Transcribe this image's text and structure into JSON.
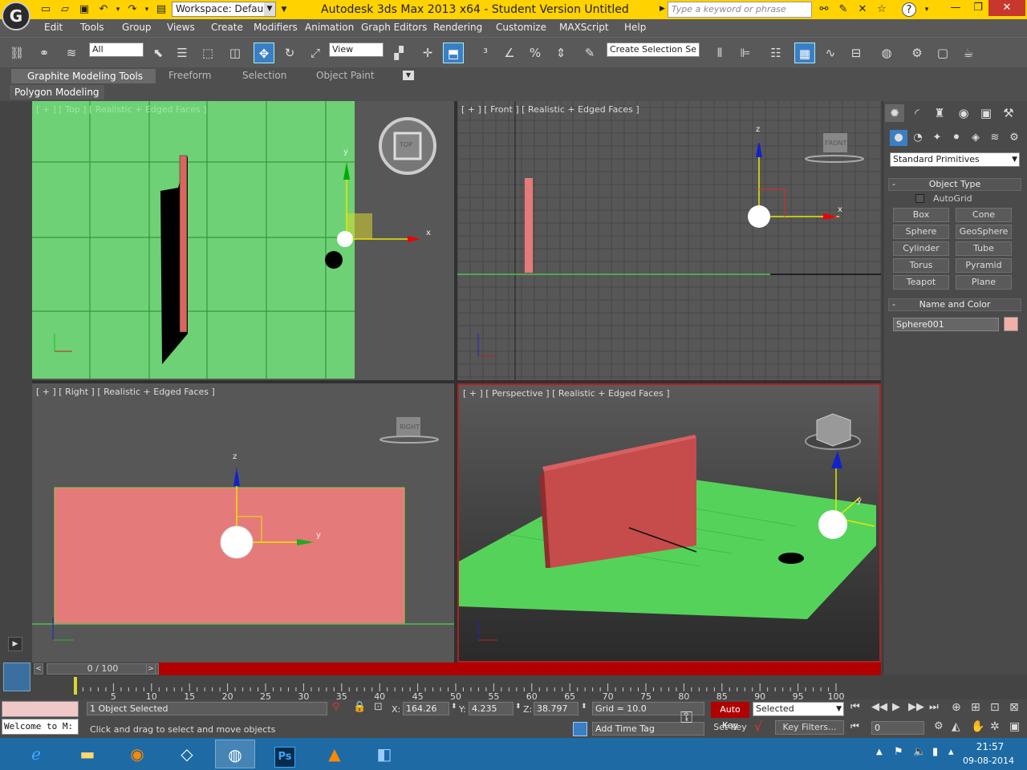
{
  "titlebar": {
    "logo": "G",
    "workspace_label": "Workspace: Default",
    "app_title": "Autodesk 3ds Max  2013 x64   - Student Version    Untitled",
    "search_placeholder": "Type a keyword or phrase",
    "minimize": "—",
    "restore": "❐",
    "close": "✕"
  },
  "menu": [
    "Edit",
    "Tools",
    "Group",
    "Views",
    "Create",
    "Modifiers",
    "Animation",
    "Graph Editors",
    "Rendering",
    "Customize",
    "MAXScript",
    "Help"
  ],
  "toolbar": {
    "filter": "All",
    "refcoord": "View",
    "named_selection": "Create Selection Se"
  },
  "ribbon": {
    "tabs": [
      "Graphite Modeling Tools",
      "Freeform",
      "Selection",
      "Object Paint"
    ],
    "active_tab": "Graphite Modeling Tools",
    "panel": "Polygon Modeling"
  },
  "viewports": {
    "top": {
      "label": "[ + ] [ Top ] [ Realistic + Edged Faces ]",
      "cube": "TOP"
    },
    "front": {
      "label": "[ + ] [ Front ] [ Realistic + Edged Faces ]",
      "cube": "FRONT"
    },
    "right": {
      "label": "[ + ] [ Right ] [ Realistic + Edged Faces ]",
      "cube": "RIGHT"
    },
    "perspective": {
      "label": "[ + ] [ Perspective ] [ Realistic + Edged Faces ]"
    },
    "axes": {
      "x": "x",
      "y": "y",
      "z": "z"
    }
  },
  "command_panel": {
    "category": "Standard Primitives",
    "object_type_title": "Object Type",
    "autogrid": "AutoGrid",
    "buttons": [
      "Box",
      "Cone",
      "Sphere",
      "GeoSphere",
      "Cylinder",
      "Tube",
      "Torus",
      "Pyramid",
      "Teapot",
      "Plane"
    ],
    "name_color_title": "Name and Color",
    "object_name": "Sphere001",
    "object_color": "#f0b0a8"
  },
  "timeline": {
    "frame_display": "0 / 100",
    "ticks": [
      "5",
      "10",
      "15",
      "20",
      "25",
      "30",
      "35",
      "40",
      "45",
      "50",
      "55",
      "60",
      "65",
      "70",
      "75",
      "80",
      "85",
      "90",
      "95",
      "100"
    ]
  },
  "status": {
    "listener_text": "Welcome to M:",
    "selection_info": "1 Object Selected",
    "prompt": "Click and drag to select and move objects",
    "x_label": "X:",
    "x": "164.26",
    "y_label": "Y:",
    "y": "4.235",
    "z_label": "Z:",
    "z": "38.797",
    "grid": "Grid = 10.0",
    "add_time_tag": "Add Time Tag",
    "auto_key": "Auto Key",
    "set_key": "Set Key",
    "key_mode": "Selected",
    "key_filters": "Key Filters...",
    "current_frame": "0"
  },
  "taskbar": {
    "time": "21:57",
    "date": "09-08-2014"
  }
}
